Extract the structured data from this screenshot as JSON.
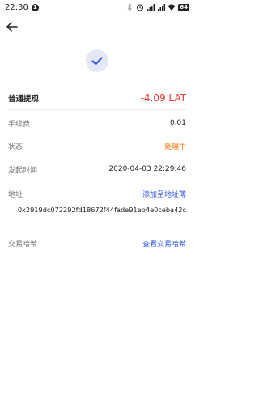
{
  "status_bar": {
    "time": "22:30",
    "notification_count": "1",
    "battery": "64"
  },
  "header": {
    "back_icon": "arrow-left-icon"
  },
  "status_icon": "check-icon",
  "colors": {
    "amount_negative": "#e53935",
    "status_processing": "#ef6c00",
    "link": "#3b5bdb",
    "check": "#3b5bdb",
    "check_bg": "#e4e7f6"
  },
  "details": {
    "type_label": "普通提现",
    "amount": "-4.09 LAT",
    "fee_label": "手续费",
    "fee_value": "0.01",
    "status_label": "状态",
    "status_value": "处理中",
    "time_label": "发起时间",
    "time_value": "2020-04-03 22:29:46",
    "address_label": "地址",
    "add_to_book": "添加至地址薄",
    "address_value": "0x2919dc072292fd18672f44fade91eb4e0ceba42c",
    "hash_label": "交易哈希",
    "view_hash": "查看交易哈希"
  }
}
